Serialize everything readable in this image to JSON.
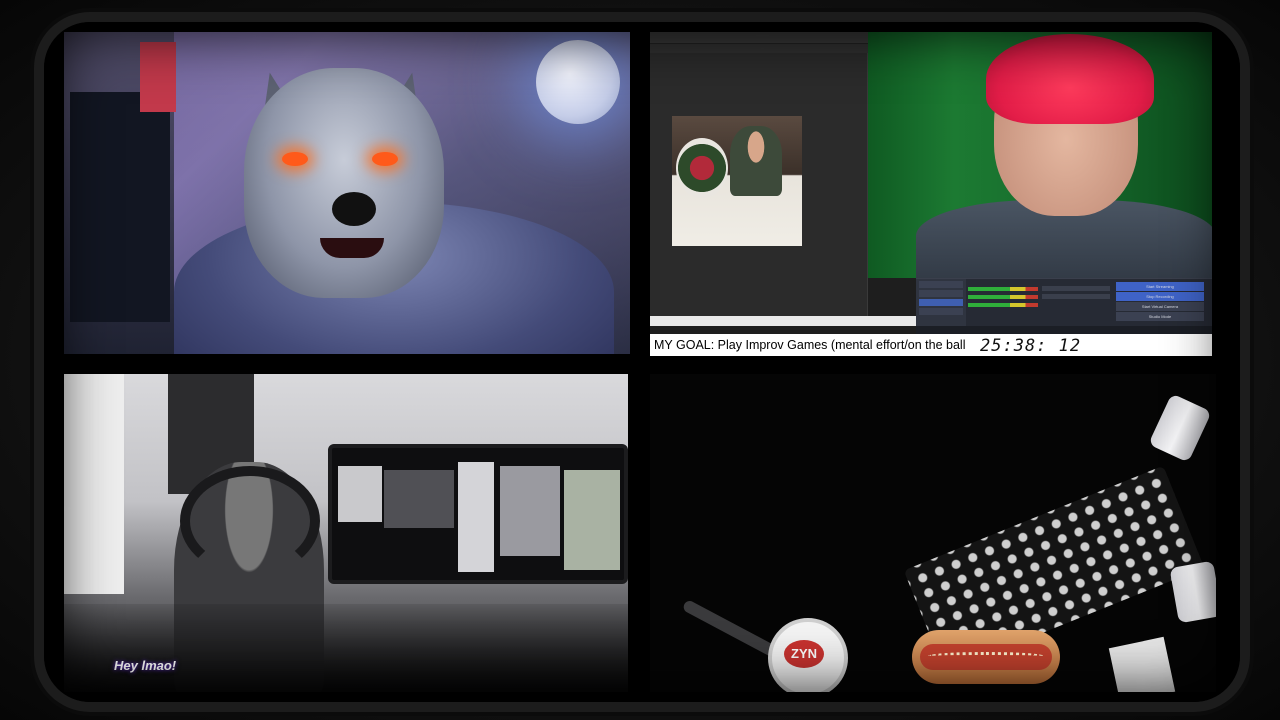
{
  "top_right": {
    "goal_text": "MY GOAL: Play Improv Games (mental effort/on the ball",
    "timer": "25:38: 12",
    "obs": {
      "buttons": [
        "Start Streaming",
        "Stop Recording",
        "Start Virtual Camera",
        "Studio Mode",
        "Settings"
      ]
    }
  },
  "bottom_left": {
    "caption": "Hey lmao!"
  },
  "bottom_right": {
    "zyn_label": "ZYN"
  },
  "colors": {
    "goal_bar_bg": "#ffffff",
    "obs_accent": "#3f63c7",
    "hair": "#e31d48",
    "green_screen": "#1c7a32"
  }
}
